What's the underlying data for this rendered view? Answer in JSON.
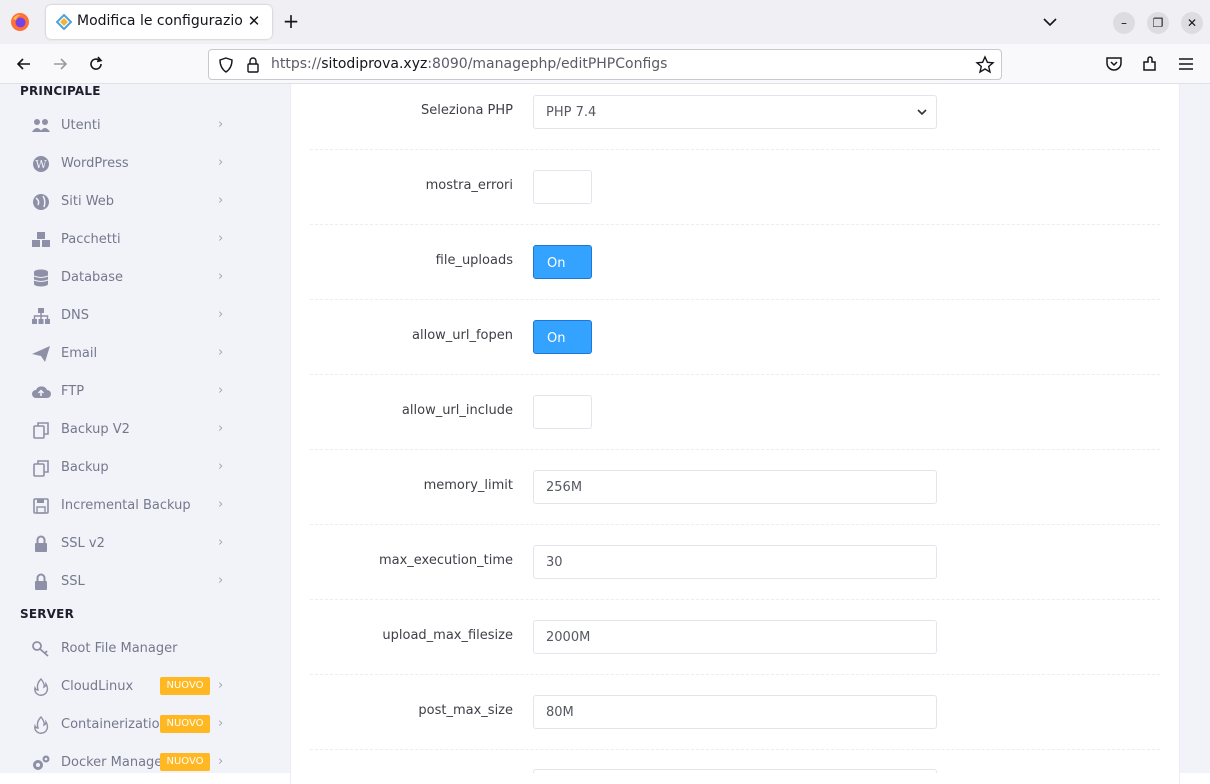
{
  "browser": {
    "tab_title": "Modifica le configurazioni",
    "url_prefix": "https://",
    "url_host": "sitodiprova.xyz",
    "url_rest": ":8090/managephp/editPHPConfigs"
  },
  "sidebar": {
    "section_main": "PRINCIPALE",
    "main_items": [
      {
        "label": "Utenti",
        "icon": "users-icon"
      },
      {
        "label": "WordPress",
        "icon": "wordpress-icon"
      },
      {
        "label": "Siti Web",
        "icon": "globe-icon"
      },
      {
        "label": "Pacchetti",
        "icon": "cubes-icon"
      },
      {
        "label": "Database",
        "icon": "database-icon"
      },
      {
        "label": "DNS",
        "icon": "sitemap-icon"
      },
      {
        "label": "Email",
        "icon": "paper-plane-icon"
      },
      {
        "label": "FTP",
        "icon": "cloud-upload-icon"
      },
      {
        "label": "Backup V2",
        "icon": "copy-icon"
      },
      {
        "label": "Backup",
        "icon": "copy-icon"
      },
      {
        "label": "Incremental Backup",
        "icon": "save-icon"
      },
      {
        "label": "SSL v2",
        "icon": "lock-icon"
      },
      {
        "label": "SSL",
        "icon": "lock-icon"
      }
    ],
    "section_server": "SERVER",
    "server_items": [
      {
        "label": "Root File Manager",
        "icon": "key-icon",
        "badge": ""
      },
      {
        "label": "CloudLinux",
        "icon": "fire-icon",
        "badge": "NUOVO"
      },
      {
        "label": "Containerization",
        "icon": "fire-icon",
        "badge": "NUOVO"
      },
      {
        "label": "Docker Manager",
        "icon": "cogs-icon",
        "badge": "NUOVO"
      }
    ]
  },
  "form": {
    "php_select_label": "Seleziona PHP",
    "php_select_value": "PHP 7.4",
    "display_errors_label": "mostra_errori",
    "display_errors_value": "",
    "file_uploads_label": "file_uploads",
    "file_uploads_value": "On",
    "allow_url_fopen_label": "allow_url_fopen",
    "allow_url_fopen_value": "On",
    "allow_url_include_label": "allow_url_include",
    "allow_url_include_value": "",
    "memory_limit_label": "memory_limit",
    "memory_limit_value": "256M",
    "max_execution_time_label": "max_execution_time",
    "max_execution_time_value": "30",
    "upload_max_filesize_label": "upload_max_filesize",
    "upload_max_filesize_value": "2000M",
    "post_max_size_label": "post_max_size",
    "post_max_size_value": "80M"
  },
  "colors": {
    "toggle_on": "#34a3ff",
    "badge": "#ffb822",
    "sidebar_bg": "#f2f3f8",
    "sidebar_text": "#74788d"
  }
}
